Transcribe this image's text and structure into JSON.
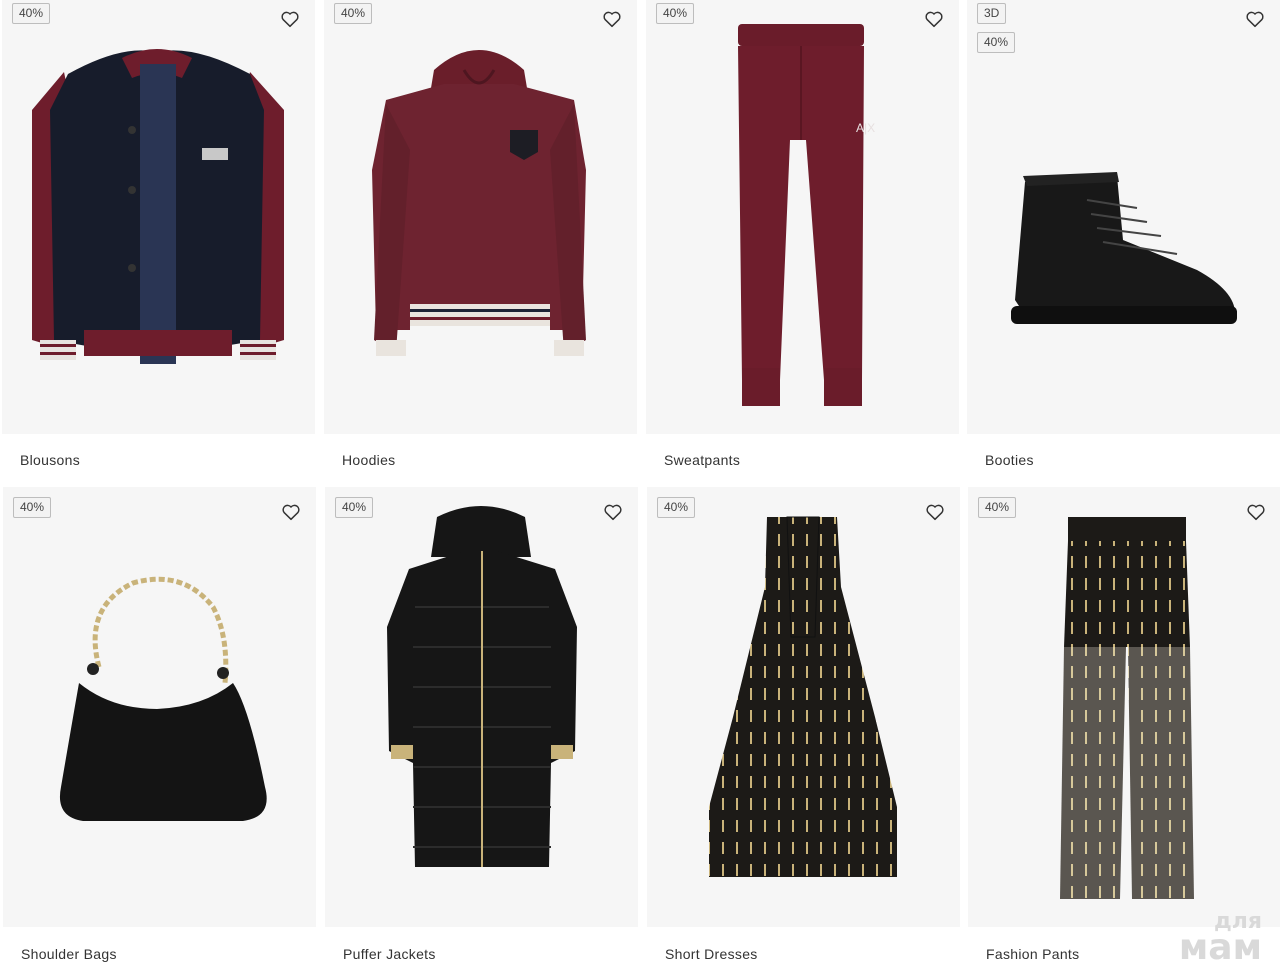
{
  "products": [
    {
      "label": "Blousons",
      "badges": [
        "40%"
      ]
    },
    {
      "label": "Hoodies",
      "badges": [
        "40%"
      ]
    },
    {
      "label": "Sweatpants",
      "badges": [
        "40%"
      ]
    },
    {
      "label": "Booties",
      "badges": [
        "3D",
        "40%"
      ]
    },
    {
      "label": "Shoulder Bags",
      "badges": [
        "40%"
      ]
    },
    {
      "label": "Puffer Jackets",
      "badges": [
        "40%"
      ]
    },
    {
      "label": "Short Dresses",
      "badges": [
        "40%"
      ]
    },
    {
      "label": "Fashion Pants",
      "badges": [
        "40%"
      ]
    }
  ],
  "watermark": {
    "line1": "для",
    "line2": "мам"
  },
  "colors": {
    "burgundy": "#6e1d2c",
    "navy": "#1a2233",
    "black": "#161616",
    "gold": "#c9b37a",
    "card_bg": "#f6f6f6"
  }
}
